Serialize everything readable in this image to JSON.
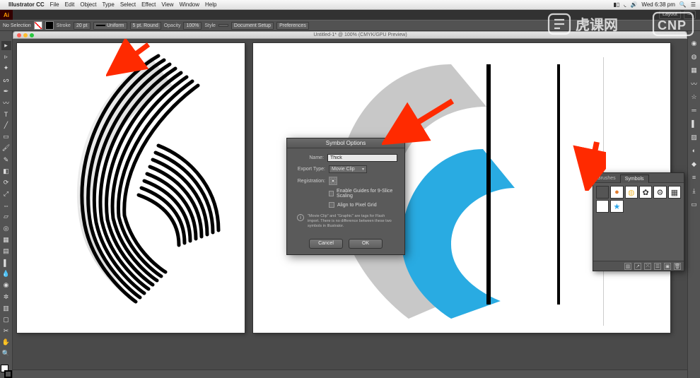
{
  "mac_menu": {
    "apple": "",
    "app": "Illustrator CC",
    "items": [
      "File",
      "Edit",
      "Object",
      "Type",
      "Select",
      "Effect",
      "View",
      "Window",
      "Help"
    ],
    "right": {
      "battery": "",
      "wifi": "",
      "vol": "",
      "clock": "Wed 6:38 pm",
      "spotlight": "",
      "notif": ""
    }
  },
  "topbar": {
    "badge": "Ai",
    "right": [
      "Layout",
      "⋯"
    ]
  },
  "control": {
    "no_selection": "No Selection",
    "stroke_lbl": "Stroke",
    "stroke_val": "20 pt",
    "uniform": "Uniform",
    "profile": "5 pt. Round",
    "opacity_lbl": "Opacity",
    "opacity_val": "100%",
    "style_lbl": "Style",
    "doc_setup": "Document Setup",
    "prefs": "Preferences"
  },
  "doc": {
    "title": "Untitled-1* @ 100% (CMYK/GPU Preview)"
  },
  "dialog": {
    "title": "Symbol Options",
    "name_lbl": "Name:",
    "name_val": "Thick",
    "export_lbl": "Export Type:",
    "export_val": "Movie Clip",
    "reg_lbl": "Registration:",
    "chk1": "Enable Guides for 9-Slice Scaling",
    "chk2": "Align to Pixel Grid",
    "info": "\"Movie Clip\" and \"Graphic\" are tags for Flash import. There is no difference between these two symbols in Illustrator.",
    "cancel": "Cancel",
    "ok": "OK"
  },
  "symbols_panel": {
    "tab_brushes": "Brushes",
    "tab_symbols": "Symbols"
  },
  "colors": {
    "arrow": "#ff2a00",
    "blue_swoosh": "#29abe2",
    "grey_swoosh": "#c8c8c8"
  }
}
